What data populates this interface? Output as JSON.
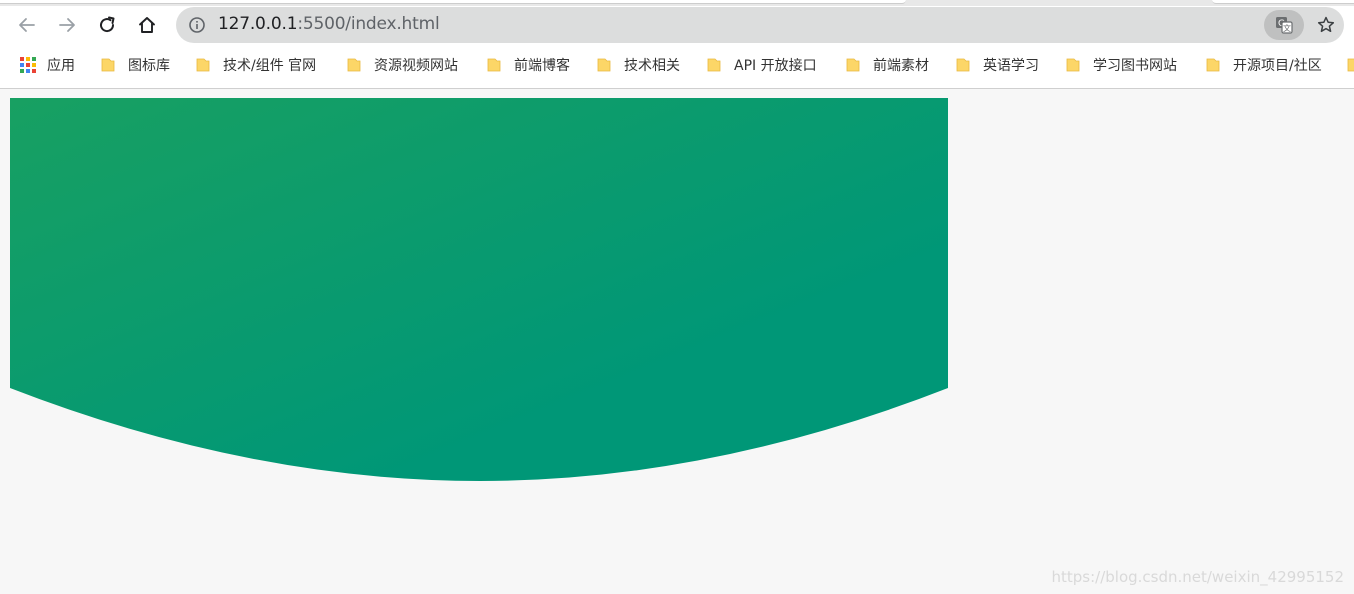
{
  "browser": {
    "url_host": "127.0.0.1",
    "url_rest": ":5500/index.html",
    "icons": {
      "back": "arrow-left-icon",
      "forward": "arrow-right-icon",
      "reload": "reload-icon",
      "home": "home-icon",
      "site_info": "info-icon",
      "translate": "translate-icon",
      "bookmark_star": "star-icon"
    }
  },
  "bookmarks": {
    "apps_label": "应用",
    "items": [
      {
        "label": "图标库"
      },
      {
        "label": "技术/组件 官网"
      },
      {
        "label": "资源视频网站"
      },
      {
        "label": "前端博客"
      },
      {
        "label": "技术相关"
      },
      {
        "label": "API 开放接口"
      },
      {
        "label": "前端素材"
      },
      {
        "label": "英语学习"
      },
      {
        "label": "学习图书网站"
      },
      {
        "label": "开源项目/社区"
      }
    ]
  },
  "page": {
    "hero_colors": {
      "start": "#18a062",
      "end": "#009777"
    },
    "background": "#f7f7f7"
  },
  "watermark": "https://blog.csdn.net/weixin_42995152"
}
